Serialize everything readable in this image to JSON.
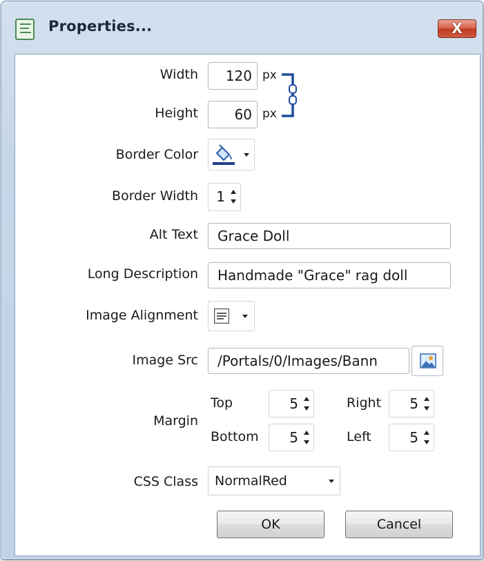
{
  "window": {
    "title": "Properties...",
    "close_glyph": "X",
    "icon": "properties-dialog-icon"
  },
  "fields": {
    "width": {
      "label": "Width",
      "value": "120",
      "unit": "px"
    },
    "height": {
      "label": "Height",
      "value": "60",
      "unit": "px"
    },
    "aspect_lock_icon": "chain-link-icon",
    "border_color": {
      "label": "Border Color",
      "icon": "paint-bucket-icon",
      "swatch": "#1f3f8f"
    },
    "border_width": {
      "label": "Border Width",
      "value": "1"
    },
    "alt_text": {
      "label": "Alt Text",
      "value": "Grace Doll"
    },
    "long_description": {
      "label": "Long Description",
      "value": "Handmade \"Grace\"  rag doll"
    },
    "image_alignment": {
      "label": "Image Alignment",
      "icon": "align-text-icon"
    },
    "image_src": {
      "label": "Image Src",
      "value": "/Portals/0/Images/Bann",
      "browse_icon": "image-browse-icon"
    },
    "margin": {
      "label": "Margin",
      "top_label": "Top",
      "top": "5",
      "bottom_label": "Bottom",
      "bottom": "5",
      "right_label": "Right",
      "right": "5",
      "left_label": "Left",
      "left": "5"
    },
    "css_class": {
      "label": "CSS Class",
      "value": "NormalRed"
    }
  },
  "buttons": {
    "ok": "OK",
    "cancel": "Cancel"
  }
}
